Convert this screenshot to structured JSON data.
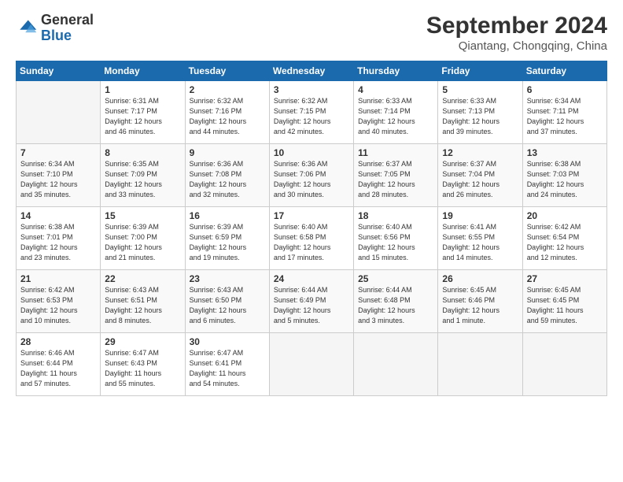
{
  "logo": {
    "general": "General",
    "blue": "Blue"
  },
  "header": {
    "title": "September 2024",
    "subtitle": "Qiantang, Chongqing, China"
  },
  "weekdays": [
    "Sunday",
    "Monday",
    "Tuesday",
    "Wednesday",
    "Thursday",
    "Friday",
    "Saturday"
  ],
  "days": [
    {
      "num": "",
      "info": ""
    },
    {
      "num": "1",
      "info": "Sunrise: 6:31 AM\nSunset: 7:17 PM\nDaylight: 12 hours\nand 46 minutes."
    },
    {
      "num": "2",
      "info": "Sunrise: 6:32 AM\nSunset: 7:16 PM\nDaylight: 12 hours\nand 44 minutes."
    },
    {
      "num": "3",
      "info": "Sunrise: 6:32 AM\nSunset: 7:15 PM\nDaylight: 12 hours\nand 42 minutes."
    },
    {
      "num": "4",
      "info": "Sunrise: 6:33 AM\nSunset: 7:14 PM\nDaylight: 12 hours\nand 40 minutes."
    },
    {
      "num": "5",
      "info": "Sunrise: 6:33 AM\nSunset: 7:13 PM\nDaylight: 12 hours\nand 39 minutes."
    },
    {
      "num": "6",
      "info": "Sunrise: 6:34 AM\nSunset: 7:11 PM\nDaylight: 12 hours\nand 37 minutes."
    },
    {
      "num": "7",
      "info": "Sunrise: 6:34 AM\nSunset: 7:10 PM\nDaylight: 12 hours\nand 35 minutes."
    },
    {
      "num": "8",
      "info": "Sunrise: 6:35 AM\nSunset: 7:09 PM\nDaylight: 12 hours\nand 33 minutes."
    },
    {
      "num": "9",
      "info": "Sunrise: 6:36 AM\nSunset: 7:08 PM\nDaylight: 12 hours\nand 32 minutes."
    },
    {
      "num": "10",
      "info": "Sunrise: 6:36 AM\nSunset: 7:06 PM\nDaylight: 12 hours\nand 30 minutes."
    },
    {
      "num": "11",
      "info": "Sunrise: 6:37 AM\nSunset: 7:05 PM\nDaylight: 12 hours\nand 28 minutes."
    },
    {
      "num": "12",
      "info": "Sunrise: 6:37 AM\nSunset: 7:04 PM\nDaylight: 12 hours\nand 26 minutes."
    },
    {
      "num": "13",
      "info": "Sunrise: 6:38 AM\nSunset: 7:03 PM\nDaylight: 12 hours\nand 24 minutes."
    },
    {
      "num": "14",
      "info": "Sunrise: 6:38 AM\nSunset: 7:01 PM\nDaylight: 12 hours\nand 23 minutes."
    },
    {
      "num": "15",
      "info": "Sunrise: 6:39 AM\nSunset: 7:00 PM\nDaylight: 12 hours\nand 21 minutes."
    },
    {
      "num": "16",
      "info": "Sunrise: 6:39 AM\nSunset: 6:59 PM\nDaylight: 12 hours\nand 19 minutes."
    },
    {
      "num": "17",
      "info": "Sunrise: 6:40 AM\nSunset: 6:58 PM\nDaylight: 12 hours\nand 17 minutes."
    },
    {
      "num": "18",
      "info": "Sunrise: 6:40 AM\nSunset: 6:56 PM\nDaylight: 12 hours\nand 15 minutes."
    },
    {
      "num": "19",
      "info": "Sunrise: 6:41 AM\nSunset: 6:55 PM\nDaylight: 12 hours\nand 14 minutes."
    },
    {
      "num": "20",
      "info": "Sunrise: 6:42 AM\nSunset: 6:54 PM\nDaylight: 12 hours\nand 12 minutes."
    },
    {
      "num": "21",
      "info": "Sunrise: 6:42 AM\nSunset: 6:53 PM\nDaylight: 12 hours\nand 10 minutes."
    },
    {
      "num": "22",
      "info": "Sunrise: 6:43 AM\nSunset: 6:51 PM\nDaylight: 12 hours\nand 8 minutes."
    },
    {
      "num": "23",
      "info": "Sunrise: 6:43 AM\nSunset: 6:50 PM\nDaylight: 12 hours\nand 6 minutes."
    },
    {
      "num": "24",
      "info": "Sunrise: 6:44 AM\nSunset: 6:49 PM\nDaylight: 12 hours\nand 5 minutes."
    },
    {
      "num": "25",
      "info": "Sunrise: 6:44 AM\nSunset: 6:48 PM\nDaylight: 12 hours\nand 3 minutes."
    },
    {
      "num": "26",
      "info": "Sunrise: 6:45 AM\nSunset: 6:46 PM\nDaylight: 12 hours\nand 1 minute."
    },
    {
      "num": "27",
      "info": "Sunrise: 6:45 AM\nSunset: 6:45 PM\nDaylight: 11 hours\nand 59 minutes."
    },
    {
      "num": "28",
      "info": "Sunrise: 6:46 AM\nSunset: 6:44 PM\nDaylight: 11 hours\nand 57 minutes."
    },
    {
      "num": "29",
      "info": "Sunrise: 6:47 AM\nSunset: 6:43 PM\nDaylight: 11 hours\nand 55 minutes."
    },
    {
      "num": "30",
      "info": "Sunrise: 6:47 AM\nSunset: 6:41 PM\nDaylight: 11 hours\nand 54 minutes."
    },
    {
      "num": "",
      "info": ""
    },
    {
      "num": "",
      "info": ""
    },
    {
      "num": "",
      "info": ""
    },
    {
      "num": "",
      "info": ""
    },
    {
      "num": "",
      "info": ""
    }
  ]
}
